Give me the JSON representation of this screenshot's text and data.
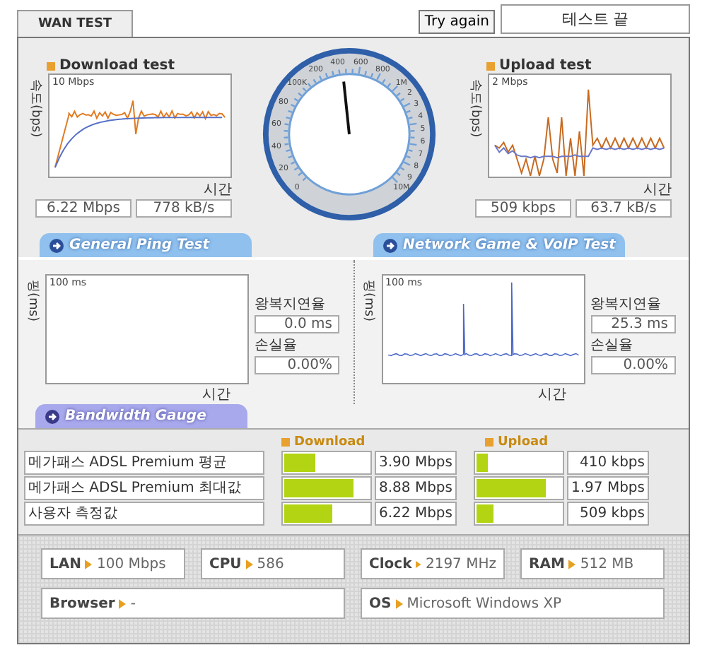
{
  "tab": {
    "label": "WAN TEST",
    "selected": true
  },
  "try_again_button": "Try again",
  "status": "테스트 끝",
  "download": {
    "title": "Download test",
    "axis_label": "속도(bps)",
    "scale": "10 Mbps",
    "time_label": "시간",
    "rate": "6.22 Mbps",
    "bytes": "778 kB/s"
  },
  "gauge": {
    "labels": [
      "0",
      "20",
      "40",
      "60",
      "80",
      "100K",
      "200",
      "400",
      "600",
      "800",
      "1M",
      "2",
      "3",
      "4",
      "5",
      "6",
      "7",
      "8",
      "9",
      "10M"
    ]
  },
  "upload": {
    "title": "Upload test",
    "axis_label": "속도(bps)",
    "scale": "2 Mbps",
    "time_label": "시간",
    "rate": "509 kbps",
    "bytes": "63.7 kB/s"
  },
  "ping_tests": [
    {
      "title": "General Ping Test",
      "kind": "empty",
      "axis_label": "핑(ms)",
      "scale": "100 ms",
      "time_label": "시간",
      "latency_label": "왕복지연율",
      "latency": "0.0 ms",
      "loss_label": "손실율",
      "loss": "0.00%"
    },
    {
      "title": "Network Game & VoIP Test",
      "kind": "trace",
      "axis_label": "핑(ms)",
      "scale": "100 ms",
      "time_label": "시간",
      "latency_label": "왕복지연율",
      "latency": "25.3 ms",
      "loss_label": "손실율",
      "loss": "0.00%"
    }
  ],
  "bandwidth": {
    "title": "Bandwidth Gauge",
    "columns": [
      "Download",
      "Upload"
    ],
    "rows": [
      {
        "label": "메가패스 ADSL Premium 평균",
        "download": {
          "value": "3.90 Mbps",
          "level": 0.36
        },
        "upload": {
          "value": "410 kbps",
          "level": 0.13
        }
      },
      {
        "label": "메가패스 ADSL Premium 최대값",
        "download": {
          "value": "8.88 Mbps",
          "level": 0.82
        },
        "upload": {
          "value": "1.97 Mbps",
          "level": 0.82
        }
      },
      {
        "label": "사용자 측정값",
        "download": {
          "value": "6.22 Mbps",
          "level": 0.57
        },
        "upload": {
          "value": "509 kbps",
          "level": 0.2
        }
      }
    ]
  },
  "system": [
    {
      "label": "LAN",
      "value": "100 Mbps"
    },
    {
      "label": "CPU",
      "value": "586"
    },
    {
      "label": "Clock",
      "value": "2197 MHz"
    },
    {
      "label": "RAM",
      "value": "512 MB"
    },
    {
      "label": "Browser",
      "value": "-"
    },
    {
      "label": "OS",
      "value": "Microsoft Windows XP"
    }
  ]
}
